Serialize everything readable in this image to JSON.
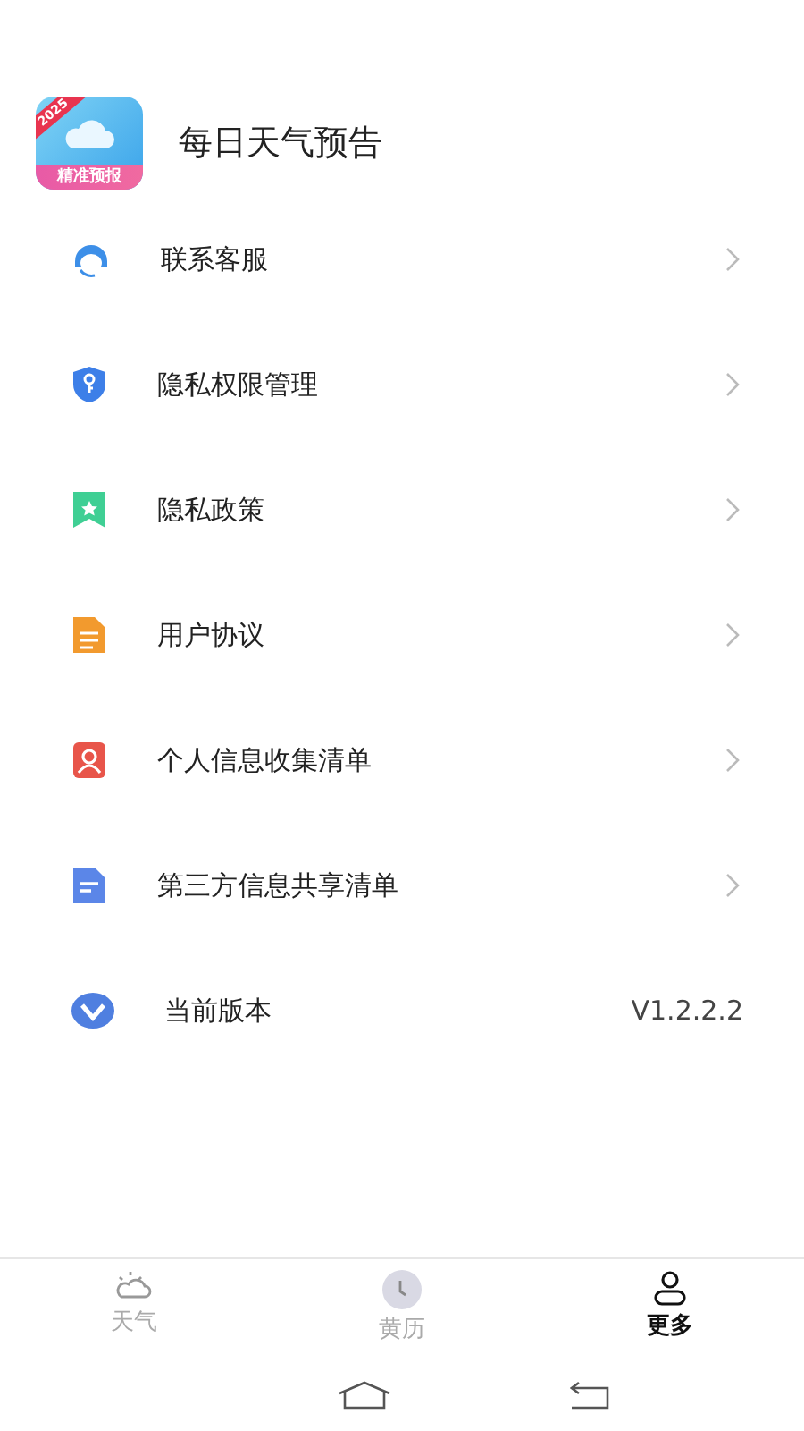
{
  "app": {
    "name": "每日天气预告",
    "icon_badge": "2025",
    "icon_banner": "精准预报"
  },
  "menu": [
    {
      "kind": "link",
      "label": "联系客服"
    },
    {
      "kind": "link",
      "label": "隐私权限管理"
    },
    {
      "kind": "link",
      "label": "隐私政策"
    },
    {
      "kind": "link",
      "label": "用户协议"
    },
    {
      "kind": "link",
      "label": "个人信息收集清单"
    },
    {
      "kind": "link",
      "label": "第三方信息共享清单"
    },
    {
      "kind": "value",
      "label": "当前版本",
      "value": "V1.2.2.2"
    }
  ],
  "tabs": [
    {
      "label": "天气",
      "selected": false
    },
    {
      "label": "黄历",
      "selected": false
    },
    {
      "label": "更多",
      "selected": true
    }
  ]
}
